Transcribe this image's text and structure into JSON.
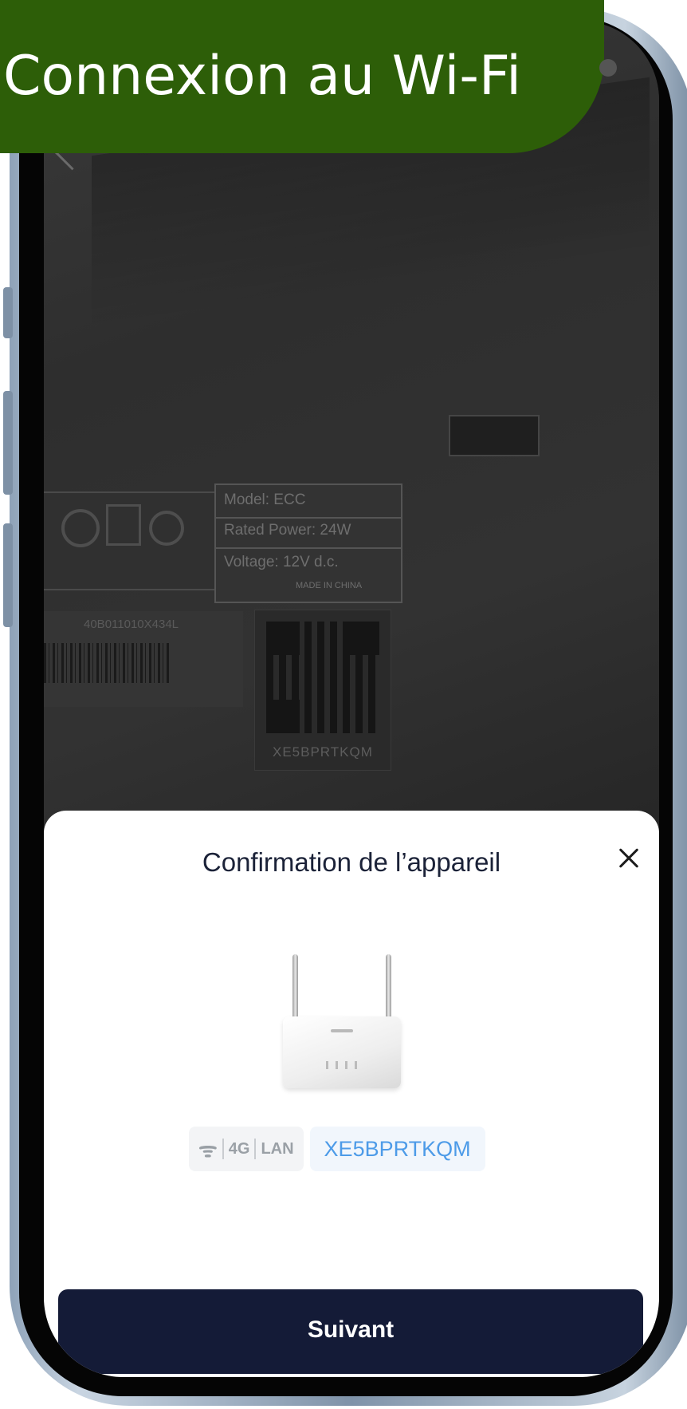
{
  "banner": {
    "title": "Connexion au Wi-Fi"
  },
  "camera_view": {
    "label_lines": [
      "Model: ECC",
      "Rated Power: 24W",
      "Voltage: 12V d.c.",
      "MADE IN CHINA"
    ],
    "barcode_number": "40B011010X434L",
    "qr_code_text": "XE5BPRTKQM"
  },
  "sheet": {
    "title": "Confirmation de l’appareil",
    "connectivity_labels": {
      "cellular": "4G",
      "lan": "LAN"
    },
    "device_id": "XE5BPRTKQM",
    "next_button": "Suivant"
  },
  "icons": [
    "back-chevron-icon",
    "close-icon",
    "wifi-icon",
    "router-image"
  ],
  "colors": {
    "banner": "#2d5e08",
    "primary_button": "#141b37",
    "device_id_text": "#4d9be8",
    "title_text": "#1b2238"
  }
}
